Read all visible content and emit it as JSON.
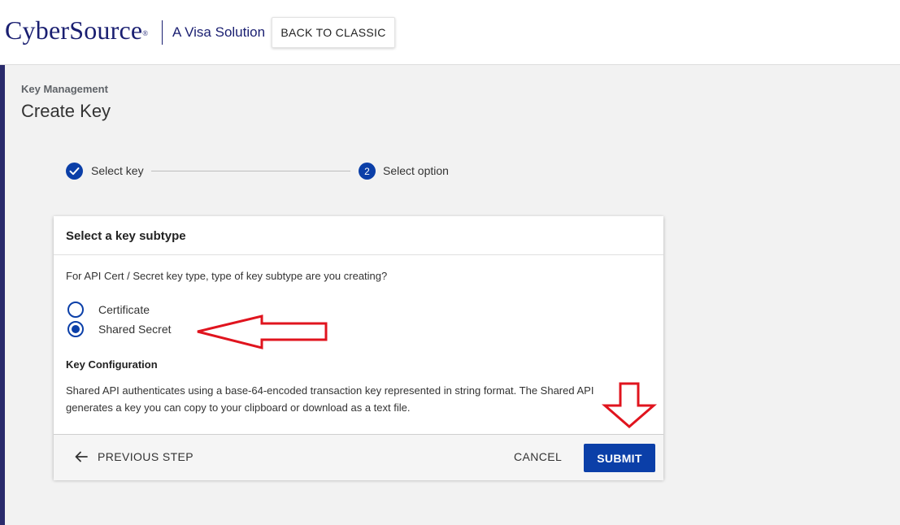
{
  "header": {
    "logo_text": "CyberSource",
    "logo_mark": "®",
    "tagline": "A Visa Solution",
    "back_button_label": "BACK TO CLASSIC"
  },
  "page": {
    "breadcrumb": "Key Management",
    "title": "Create Key"
  },
  "stepper": {
    "steps": [
      {
        "label": "Select key",
        "state": "completed",
        "icon": "check-icon"
      },
      {
        "label": "Select option",
        "state": "active",
        "number": "2"
      }
    ]
  },
  "card": {
    "title": "Select a key subtype",
    "question": "For API Cert / Secret key type, type of key subtype are you creating?",
    "options": [
      {
        "label": "Certificate",
        "selected": false
      },
      {
        "label": "Shared Secret",
        "selected": true
      }
    ],
    "config_title": "Key Configuration",
    "config_text": "Shared API authenticates using a base-64-encoded transaction key represented in string format. The Shared API generates a key you can copy to your clipboard or download as a text file.",
    "footer": {
      "previous_label": "PREVIOUS STEP",
      "cancel_label": "CANCEL",
      "submit_label": "SUBMIT"
    }
  },
  "colors": {
    "brand_navy": "#1a1f71",
    "primary_blue": "#0b3fa8",
    "accent_bar": "#2a2b6c",
    "annotation_red": "#e0141e"
  },
  "icons": {
    "back_arrow": "arrow-left-icon",
    "completed_step": "check-icon",
    "annotation_left": "red-left-arrow-icon",
    "annotation_down": "red-down-arrow-icon"
  }
}
